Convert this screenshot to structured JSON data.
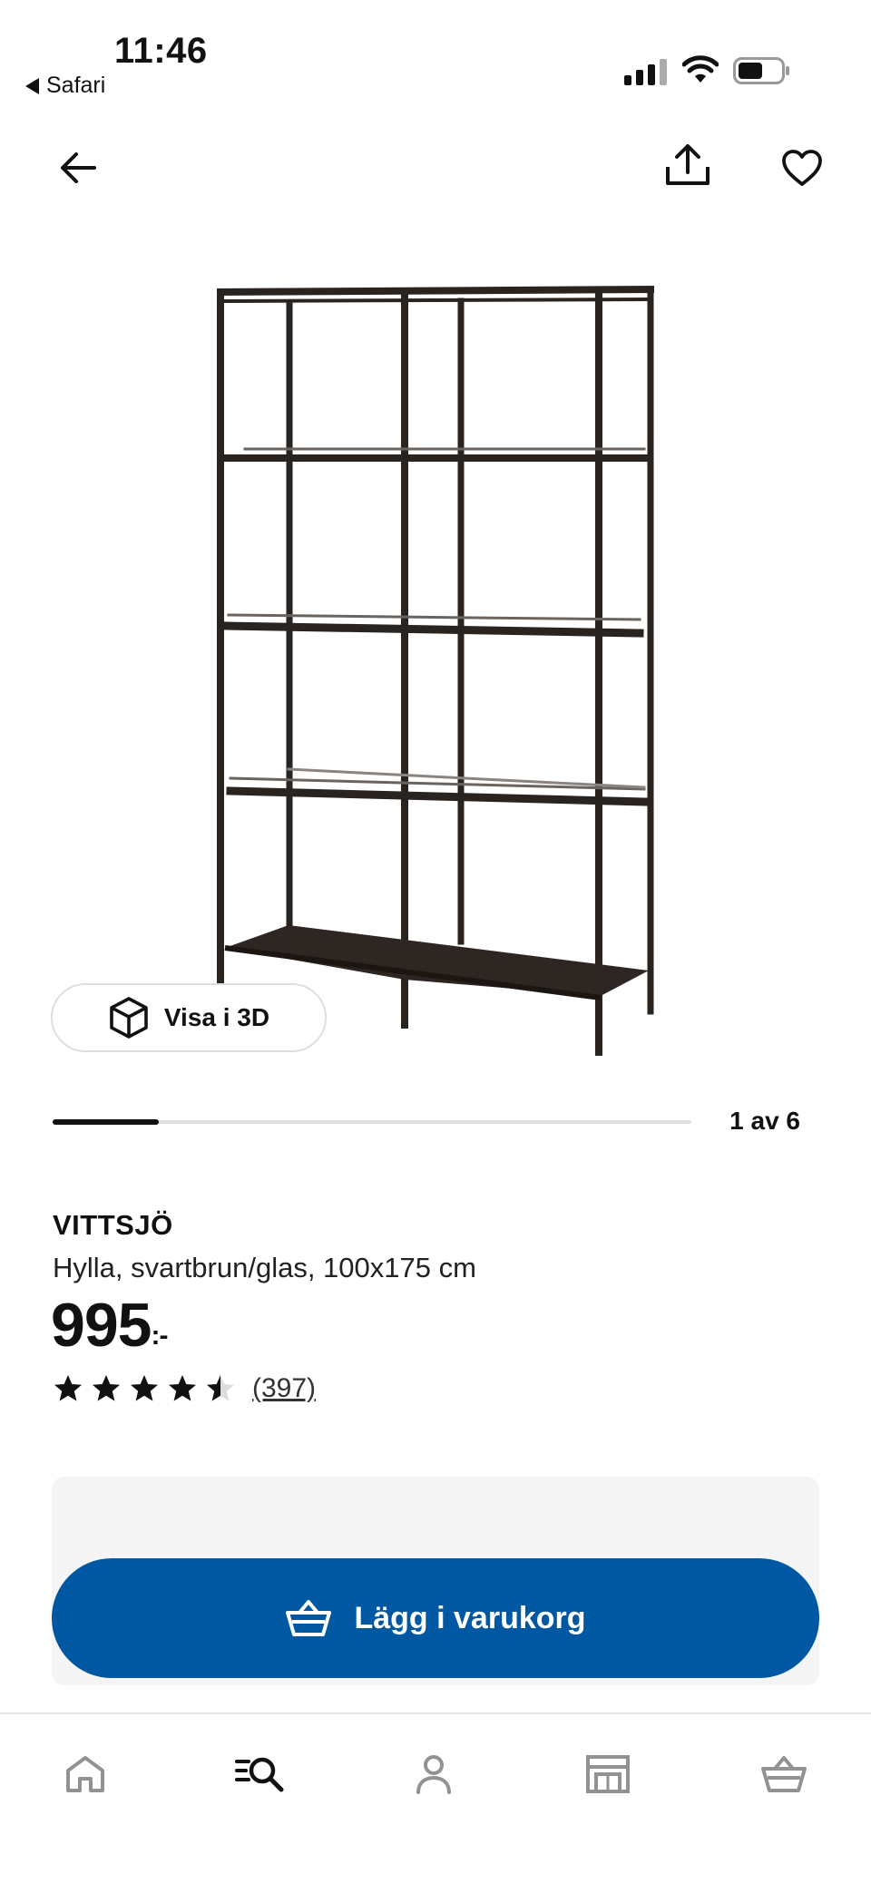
{
  "status_bar": {
    "time": "11:46",
    "back_app": "Safari"
  },
  "nav": {
    "back_icon": "arrow-left-icon",
    "share_icon": "share-icon",
    "favorite_icon": "heart-icon"
  },
  "gallery": {
    "view_3d_label": "Visa i 3D",
    "view_3d_icon": "cube-icon",
    "current_image": 1,
    "total_images": 6,
    "position_text": "1 av 6"
  },
  "product": {
    "name": "VITTSJÖ",
    "description": "Hylla, svartbrun/glas, 100x175 cm",
    "price": "995",
    "price_suffix": ":-",
    "rating": 4.5,
    "rating_max": 5,
    "review_count": "(397)"
  },
  "cta": {
    "label": "Lägg i varukorg",
    "icon": "basket-icon"
  },
  "tab_bar": {
    "items": [
      {
        "icon": "home-icon",
        "active": false
      },
      {
        "icon": "search-icon",
        "active": true
      },
      {
        "icon": "profile-icon",
        "active": false
      },
      {
        "icon": "store-icon",
        "active": false
      },
      {
        "icon": "basket-icon",
        "active": false
      }
    ]
  },
  "colors": {
    "brand_blue": "#0058a3",
    "text": "#111111",
    "inactive_icon": "#929292",
    "panel_bg": "#f5f5f5"
  }
}
